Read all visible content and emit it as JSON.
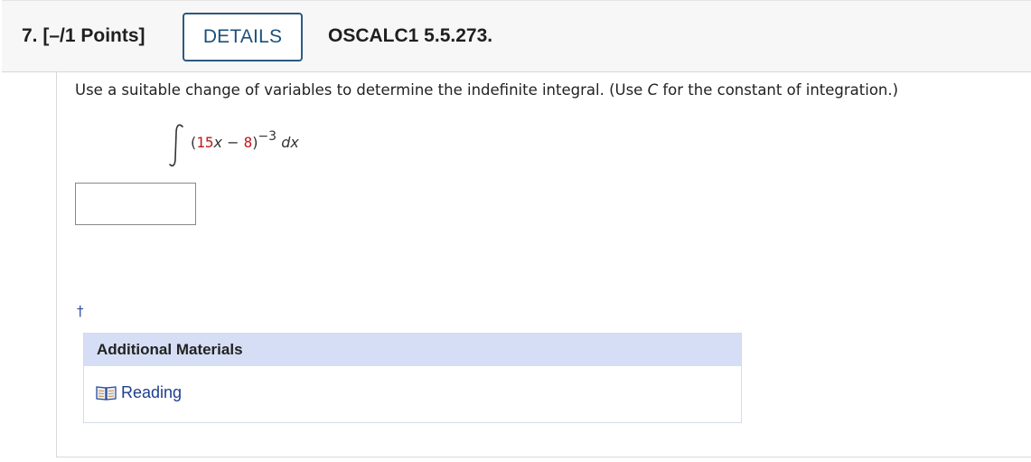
{
  "header": {
    "question_number": "7.",
    "points": "[–/1 Points]",
    "details_label": "DETAILS",
    "assignment_code": "OSCALC1 5.5.273."
  },
  "question": {
    "prompt_before_c": "Use a suitable change of variables to determine the indefinite integral. (Use ",
    "prompt_c": "C",
    "prompt_after_c": " for the constant of integration.)",
    "integral": {
      "open_paren": "(",
      "coef": "15",
      "var": "x",
      "minus": " − ",
      "const": "8",
      "close_paren": ")",
      "exponent": "−3",
      "differential": "dx"
    },
    "answer_value": ""
  },
  "footnote_marker": "†",
  "materials": {
    "title": "Additional Materials",
    "reading_label": "Reading",
    "reading_icon": "book-icon"
  },
  "colors": {
    "accent_blue": "#1d4f7c",
    "link_blue": "#1f3f8f",
    "highlight_red": "#c0181b",
    "materials_header_bg": "#d6def5"
  }
}
